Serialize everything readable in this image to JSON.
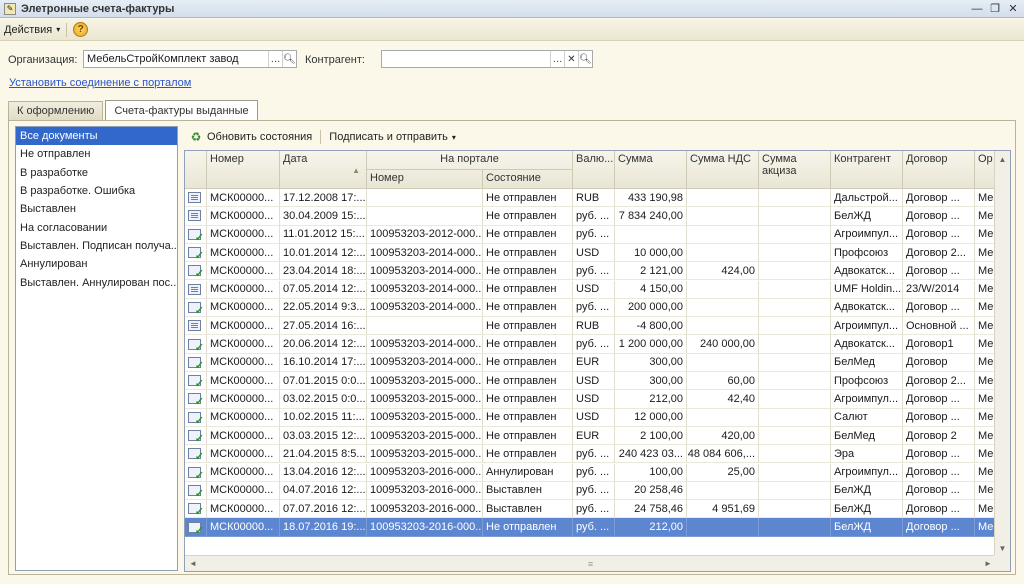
{
  "window": {
    "title": "Элетронные счета-фактуры"
  },
  "menu": {
    "actions": "Действия",
    "help": "?"
  },
  "org": {
    "label": "Организация:",
    "value": "МебельСтройКомплект завод"
  },
  "contractor": {
    "label": "Контрагент:",
    "value": ""
  },
  "portal_link": "Установить соединение с порталом",
  "tabs": [
    "К оформлению",
    "Счета-фактуры выданные"
  ],
  "filters": [
    "Все документы",
    "Не отправлен",
    "В разработке",
    "В разработке. Ошибка",
    "Выставлен",
    "На согласовании",
    "Выставлен. Подписан получа...",
    "Аннулирован",
    "Выставлен. Аннулирован пос..."
  ],
  "toolbar": {
    "refresh": "Обновить состояния",
    "sign": "Подписать и отправить"
  },
  "columns": {
    "number": "Номер",
    "date": "Дата",
    "portal": "На портале",
    "portal_number": "Номер",
    "portal_state": "Состояние",
    "currency": "Валю...",
    "sum": "Сумма",
    "vat": "Сумма НДС",
    "excise": "Сумма акциза",
    "contractor": "Контрагент",
    "contract": "Договор",
    "org": "Ор"
  },
  "rows": [
    {
      "icon": "doc",
      "num": "МСК00000...",
      "date": "17.12.2008 17:...",
      "pnum": "",
      "state": "Не отправлен",
      "cur": "RUB",
      "sum": "433 190,98",
      "vat": "",
      "exc": "",
      "ctr": "Дальстрой...",
      "dog": "Договор ...",
      "org": "Ме"
    },
    {
      "icon": "doc",
      "num": "МСК00000...",
      "date": "30.04.2009 15:...",
      "pnum": "",
      "state": "Не отправлен",
      "cur": "руб. ...",
      "sum": "7 834 240,00",
      "vat": "",
      "exc": "",
      "ctr": "БелЖД",
      "dog": "Договор ...",
      "org": "Ме"
    },
    {
      "icon": "ok",
      "num": "МСК00000...",
      "date": "11.01.2012 15:...",
      "pnum": "100953203-2012-000...",
      "state": "Не отправлен",
      "cur": "руб. ...",
      "sum": "",
      "vat": "",
      "exc": "",
      "ctr": "Агроимпул...",
      "dog": "Договор ...",
      "org": "Ме"
    },
    {
      "icon": "ok",
      "num": "МСК00000...",
      "date": "10.01.2014 12:...",
      "pnum": "100953203-2014-000...",
      "state": "Не отправлен",
      "cur": "USD",
      "sum": "10 000,00",
      "vat": "",
      "exc": "",
      "ctr": "Профсоюз",
      "dog": "Договор 2...",
      "org": "Ме"
    },
    {
      "icon": "ok",
      "num": "МСК00000...",
      "date": "23.04.2014 18:...",
      "pnum": "100953203-2014-000...",
      "state": "Не отправлен",
      "cur": "руб. ...",
      "sum": "2 121,00",
      "vat": "424,00",
      "exc": "",
      "ctr": "Адвокатск...",
      "dog": "Договор ...",
      "org": "Ме"
    },
    {
      "icon": "doc",
      "num": "МСК00000...",
      "date": "07.05.2014 12:...",
      "pnum": "100953203-2014-000...",
      "state": "Не отправлен",
      "cur": "USD",
      "sum": "4 150,00",
      "vat": "",
      "exc": "",
      "ctr": "UMF Holdin...",
      "dog": "23/W/2014",
      "org": "Ме"
    },
    {
      "icon": "ok",
      "num": "МСК00000...",
      "date": "22.05.2014 9:3...",
      "pnum": "100953203-2014-000...",
      "state": "Не отправлен",
      "cur": "руб. ...",
      "sum": "200 000,00",
      "vat": "",
      "exc": "",
      "ctr": "Адвокатск...",
      "dog": "Договор ...",
      "org": "Ме"
    },
    {
      "icon": "doc",
      "num": "МСК00000...",
      "date": "27.05.2014 16:...",
      "pnum": "",
      "state": "Не отправлен",
      "cur": "RUB",
      "sum": "-4 800,00",
      "vat": "",
      "exc": "",
      "ctr": "Агроимпул...",
      "dog": "Основной ...",
      "org": "Ме"
    },
    {
      "icon": "ok",
      "num": "МСК00000...",
      "date": "20.06.2014 12:...",
      "pnum": "100953203-2014-000...",
      "state": "Не отправлен",
      "cur": "руб. ...",
      "sum": "1 200 000,00",
      "vat": "240 000,00",
      "exc": "",
      "ctr": "Адвокатск...",
      "dog": "Договор1",
      "org": "Ме"
    },
    {
      "icon": "ok",
      "num": "МСК00000...",
      "date": "16.10.2014 17:...",
      "pnum": "100953203-2014-000...",
      "state": "Не отправлен",
      "cur": "EUR",
      "sum": "300,00",
      "vat": "",
      "exc": "",
      "ctr": "БелМед",
      "dog": "Договор",
      "org": "Ме"
    },
    {
      "icon": "ok",
      "num": "МСК00000...",
      "date": "07.01.2015 0:0...",
      "pnum": "100953203-2015-000...",
      "state": "Не отправлен",
      "cur": "USD",
      "sum": "300,00",
      "vat": "60,00",
      "exc": "",
      "ctr": "Профсоюз",
      "dog": "Договор 2...",
      "org": "Ме"
    },
    {
      "icon": "ok",
      "num": "МСК00000...",
      "date": "03.02.2015 0:0...",
      "pnum": "100953203-2015-000...",
      "state": "Не отправлен",
      "cur": "USD",
      "sum": "212,00",
      "vat": "42,40",
      "exc": "",
      "ctr": "Агроимпул...",
      "dog": "Договор ...",
      "org": "Ме"
    },
    {
      "icon": "ok",
      "num": "МСК00000...",
      "date": "10.02.2015 11:...",
      "pnum": "100953203-2015-000...",
      "state": "Не отправлен",
      "cur": "USD",
      "sum": "12 000,00",
      "vat": "",
      "exc": "",
      "ctr": "Салют",
      "dog": "Договор ...",
      "org": "Ме"
    },
    {
      "icon": "ok",
      "num": "МСК00000...",
      "date": "03.03.2015 12:...",
      "pnum": "100953203-2015-000...",
      "state": "Не отправлен",
      "cur": "EUR",
      "sum": "2 100,00",
      "vat": "420,00",
      "exc": "",
      "ctr": "БелМед",
      "dog": "Договор 2",
      "org": "Ме"
    },
    {
      "icon": "ok",
      "num": "МСК00000...",
      "date": "21.04.2015 8:5...",
      "pnum": "100953203-2015-000...",
      "state": "Не отправлен",
      "cur": "руб. ...",
      "sum": "240 423 03...",
      "vat": "48 084 606,...",
      "exc": "",
      "ctr": "Эра",
      "dog": "Договор ...",
      "org": "Ме"
    },
    {
      "icon": "ok",
      "num": "МСК00000...",
      "date": "13.04.2016 12:...",
      "pnum": "100953203-2016-000...",
      "state": "Аннулирован",
      "cur": "руб. ...",
      "sum": "100,00",
      "vat": "25,00",
      "exc": "",
      "ctr": "Агроимпул...",
      "dog": "Договор ...",
      "org": "Ме"
    },
    {
      "icon": "ok",
      "num": "МСК00000...",
      "date": "04.07.2016 12:...",
      "pnum": "100953203-2016-000...",
      "state": "Выставлен",
      "cur": "руб. ...",
      "sum": "20 258,46",
      "vat": "",
      "exc": "",
      "ctr": "БелЖД",
      "dog": "Договор ...",
      "org": "Ме"
    },
    {
      "icon": "ok",
      "num": "МСК00000...",
      "date": "07.07.2016 12:...",
      "pnum": "100953203-2016-000...",
      "state": "Выставлен",
      "cur": "руб. ...",
      "sum": "24 758,46",
      "vat": "4 951,69",
      "exc": "",
      "ctr": "БелЖД",
      "dog": "Договор ...",
      "org": "Ме"
    },
    {
      "icon": "ok",
      "num": "МСК00000...",
      "date": "18.07.2016 19:...",
      "pnum": "100953203-2016-000...",
      "state": "Не отправлен",
      "cur": "руб. ...",
      "sum": "212,00",
      "vat": "",
      "exc": "",
      "ctr": "БелЖД",
      "dog": "Договор ...",
      "org": "Ме",
      "selected": true
    }
  ]
}
